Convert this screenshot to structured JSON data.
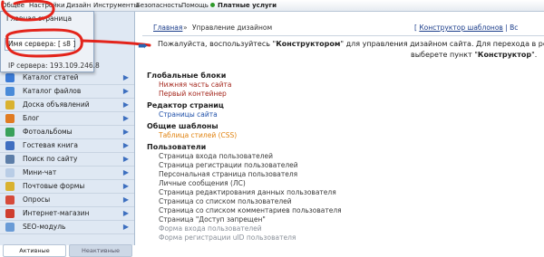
{
  "menubar": {
    "items": [
      "Общее",
      "Настройки",
      "Дизайн",
      "Инструменты",
      "Безопасность",
      "Помощь"
    ],
    "paid": "Платные услуги"
  },
  "popup": {
    "main_page": "Главная страница",
    "server_name": "Имя сервера: [ s8 ]",
    "ip": "IP сервера: 193.109.246.8"
  },
  "modules": [
    {
      "label": "Каталог статей",
      "icon": "articles-icon",
      "color": "#3b7bd6"
    },
    {
      "label": "Каталог файлов",
      "icon": "files-icon",
      "color": "#4a8bd8"
    },
    {
      "label": "Доска объявлений",
      "icon": "board-icon",
      "color": "#d9b230"
    },
    {
      "label": "Блог",
      "icon": "blog-icon",
      "color": "#e07b22"
    },
    {
      "label": "Фотоальбомы",
      "icon": "photo-icon",
      "color": "#3aa15a"
    },
    {
      "label": "Гостевая книга",
      "icon": "guestbook-icon",
      "color": "#3f6ec0"
    },
    {
      "label": "Поиск по сайту",
      "icon": "search-icon",
      "color": "#5d7ea8"
    },
    {
      "label": "Мини-чат",
      "icon": "chat-icon",
      "color": "#b9cde6"
    },
    {
      "label": "Почтовые формы",
      "icon": "mail-icon",
      "color": "#d9b230"
    },
    {
      "label": "Опросы",
      "icon": "poll-icon",
      "color": "#d64a3a"
    },
    {
      "label": "Интернет-магазин",
      "icon": "cart-icon",
      "color": "#cf3e2f"
    },
    {
      "label": "SEO-модуль",
      "icon": "seo-icon",
      "color": "#6a9bd6"
    }
  ],
  "tabs": {
    "active": "Активные",
    "inactive": "Неактивные"
  },
  "breadcrumb": {
    "home": "Главная",
    "separator": "»",
    "current": "Управление дизайном",
    "right_open": "[",
    "right_link": "Конструктор шаблонов",
    "right_close": "| Вс"
  },
  "notice": {
    "line1_a": "Пожалуйста, воспользуйтесь \"",
    "line1_b": "Конструктором",
    "line1_c": "\" для управления дизайном сайта. Для перехода в режим к",
    "line2_a": "выберете пункт \"",
    "line2_b": "Конструктор",
    "line2_c": "\"."
  },
  "sections": [
    {
      "title": "Глобальные блоки",
      "links": [
        {
          "label": "Нижняя часть сайта",
          "style": "red"
        },
        {
          "label": "Первый контейнер",
          "style": "red"
        }
      ]
    },
    {
      "title": "Редактор страниц",
      "links": [
        {
          "label": "Страницы сайта",
          "style": "blue"
        }
      ]
    },
    {
      "title": "Общие шаблоны",
      "links": [
        {
          "label": "Таблица стилей (CSS)",
          "style": "org"
        }
      ]
    },
    {
      "title": "Пользователи",
      "links": [
        {
          "label": "Страница входа пользователей",
          "style": "dark"
        },
        {
          "label": "Страница регистрации пользователей",
          "style": "dark"
        },
        {
          "label": "Персональная страница пользователя",
          "style": "dark"
        },
        {
          "label": "Личные сообщения (ЛС)",
          "style": "dark"
        },
        {
          "label": "Страница редактирования данных пользователя",
          "style": "dark"
        },
        {
          "label": "Страница со списком пользователей",
          "style": "dark"
        },
        {
          "label": "Страница со списком комментариев пользователя",
          "style": "dark"
        },
        {
          "label": "Страница \"Доступ запрещен\"",
          "style": "dark"
        },
        {
          "label": "Форма входа пользователей",
          "style": "grey"
        },
        {
          "label": "Форма регистрации uID пользователя",
          "style": "grey"
        }
      ]
    }
  ]
}
